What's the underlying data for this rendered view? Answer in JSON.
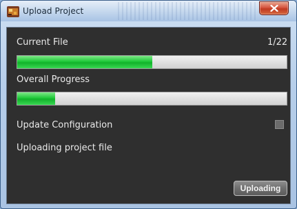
{
  "window": {
    "title": "Upload Project",
    "close_icon": "close-icon",
    "app_icon": "app-project-icon"
  },
  "current_file": {
    "label": "Current File",
    "counter": "1/22",
    "progress_fraction": 0.5
  },
  "overall": {
    "label": "Overall Progress",
    "progress_fraction": 0.14
  },
  "update_configuration": {
    "label": "Update Configuration",
    "checked": false
  },
  "status": {
    "text": "Uploading project file"
  },
  "actions": {
    "upload_button_label": "Uploading"
  },
  "colors": {
    "progress_fill": "#1fc93a",
    "client_background": "#2f2f2f"
  }
}
